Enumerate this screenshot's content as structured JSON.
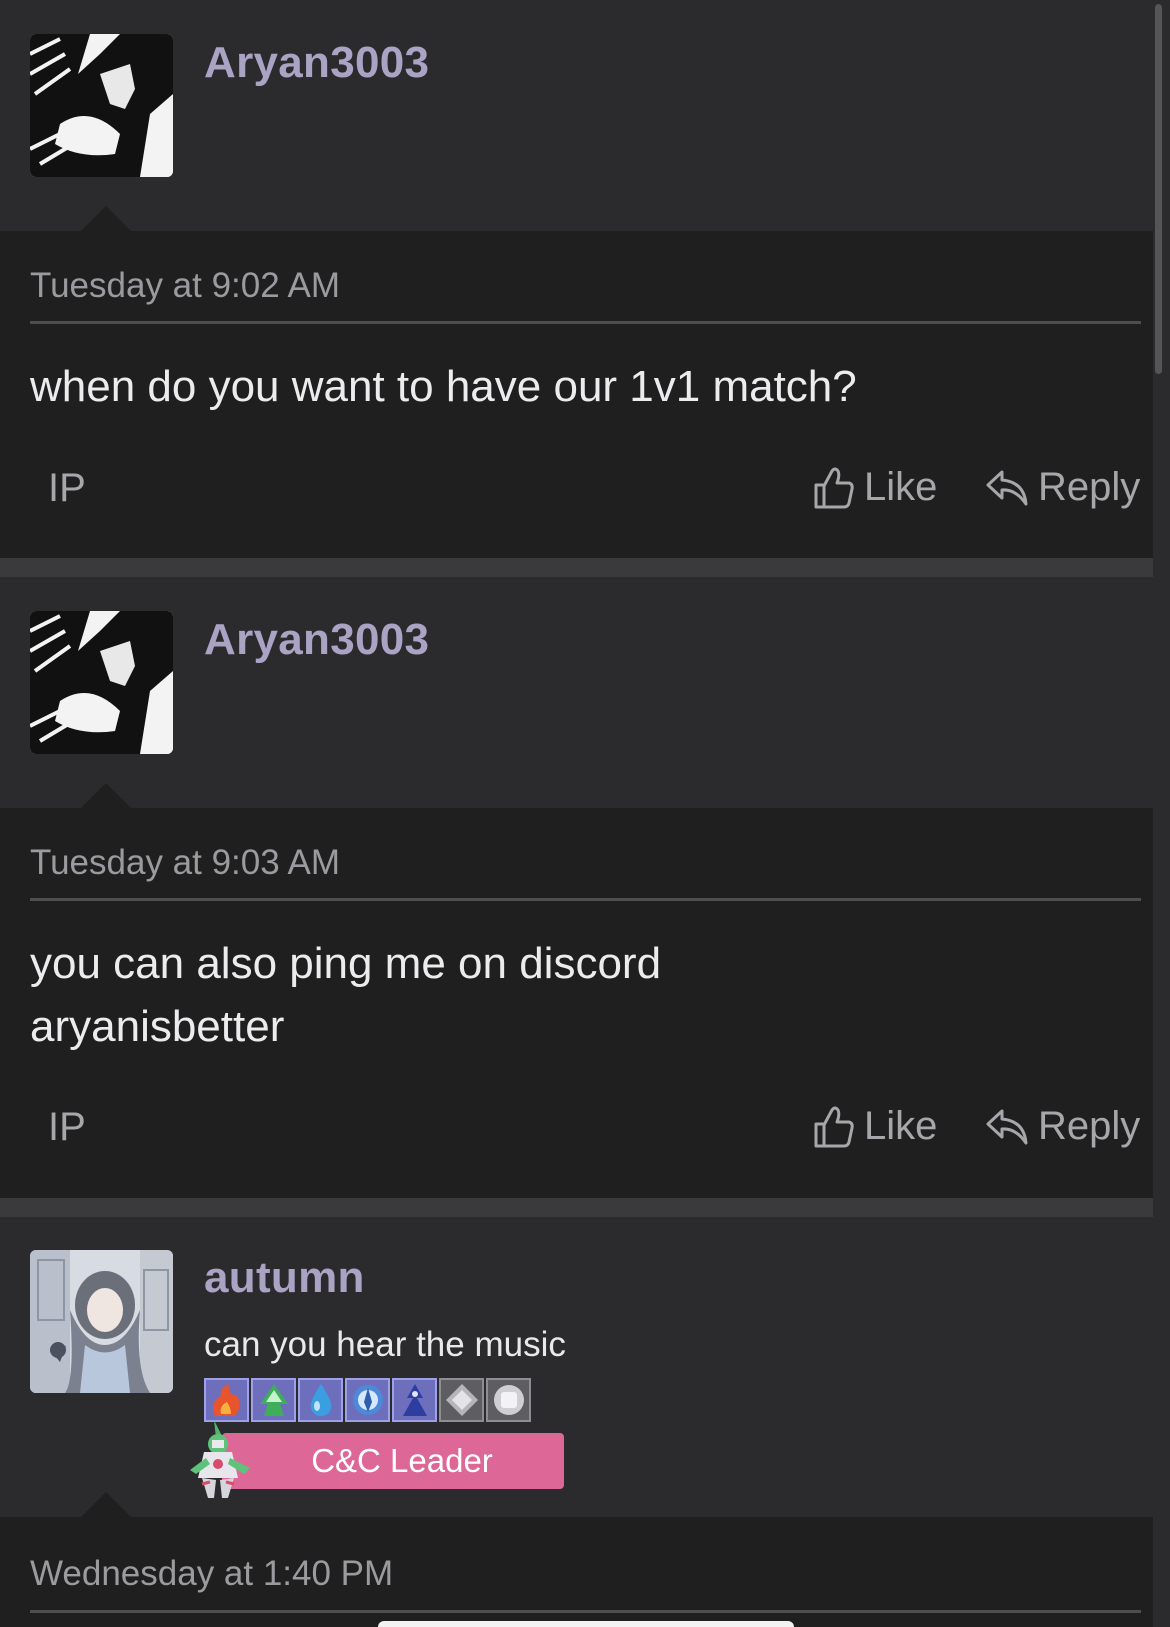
{
  "posts": [
    {
      "username": "Aryan3003",
      "avatar_icon": "manga-character-avatar",
      "timestamp": "Tuesday at 9:02 AM",
      "message_lines": [
        "when do you want to have our 1v1 match?"
      ],
      "ip_label": "IP",
      "like_label": "Like",
      "reply_label": "Reply"
    },
    {
      "username": "Aryan3003",
      "avatar_icon": "manga-character-avatar",
      "timestamp": "Tuesday at 9:03 AM",
      "message_lines": [
        "you can also ping me on discord",
        "aryanisbetter"
      ],
      "ip_label": "IP",
      "like_label": "Like",
      "reply_label": "Reply"
    },
    {
      "username": "autumn",
      "avatar_icon": "anime-girl-avatar",
      "user_title": "can you hear the music",
      "badges": [
        "fire-badge-icon",
        "leaf-badge-icon",
        "water-drop-badge-icon",
        "psychic-badge-icon",
        "dragon-badge-icon",
        "steel-badge-icon",
        "normal-badge-icon"
      ],
      "role_badge": "C&C Leader",
      "timestamp": "Wednesday at 1:40 PM"
    }
  ],
  "colors": {
    "page_bg": "#1f1f20",
    "header_bg": "#2b2b2d",
    "username": "#aba3c4",
    "role_badge_bg": "#dd6797",
    "badge_bg": "#6d6fbd"
  }
}
